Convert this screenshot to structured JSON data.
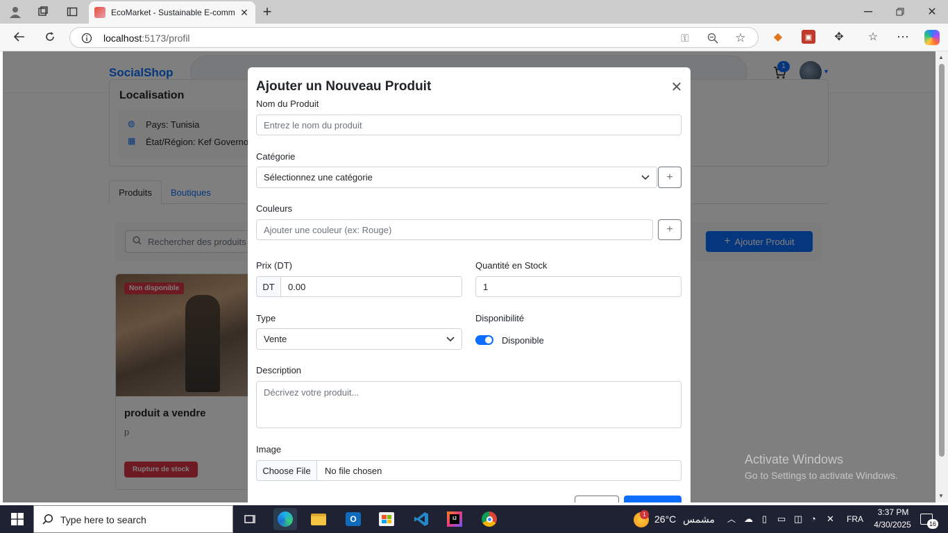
{
  "browser": {
    "tab_title": "EcoMarket - Sustainable E-comm",
    "url_host": "localhost",
    "url_rest": ":5173/profil",
    "new_tab": "+",
    "extension_count": ""
  },
  "app": {
    "brand": "SocialShop",
    "cart_count": "1"
  },
  "location": {
    "heading": "Localisation",
    "country": "Pays: Tunisia",
    "region": "État/Région: Kef Governo"
  },
  "tabs": [
    "Produits",
    "Boutiques"
  ],
  "search": {
    "placeholder": "Rechercher des produits"
  },
  "add_product_button": "Ajouter Produit",
  "product": {
    "badge": "Non disponible",
    "title": "produit a vendre",
    "desc": "p",
    "status": "Rupture de stock"
  },
  "modal": {
    "title": "Ajouter un Nouveau Produit",
    "name_label": "Nom du Produit",
    "name_placeholder": "Entrez le nom du produit",
    "category_label": "Catégorie",
    "category_value": "Sélectionnez une catégorie",
    "colors_label": "Couleurs",
    "colors_placeholder": "Ajouter une couleur (ex: Rouge)",
    "price_label": "Prix (DT)",
    "price_prefix": "DT",
    "price_value": "0.00",
    "stock_label": "Quantité en Stock",
    "stock_value": "1",
    "type_label": "Type",
    "type_value": "Vente",
    "availability_label": "Disponibilité",
    "availability_value": "Disponible",
    "description_label": "Description",
    "description_placeholder": "Décrivez votre produit...",
    "image_label": "Image",
    "file_button": "Choose File",
    "file_status": "No file chosen"
  },
  "watermark": {
    "line1": "Activate Windows",
    "line2": "Go to Settings to activate Windows."
  },
  "taskbar": {
    "search_placeholder": "Type here to search",
    "weather_temp": "26°C",
    "weather_text": "مشمس",
    "weather_badge": "1",
    "lang": "FRA",
    "time": "3:37 PM",
    "date": "4/30/2025",
    "notif_count": "16"
  },
  "colors": {
    "primary": "#0d6efd",
    "danger": "#dc3545",
    "brand": "#0d6efd"
  }
}
